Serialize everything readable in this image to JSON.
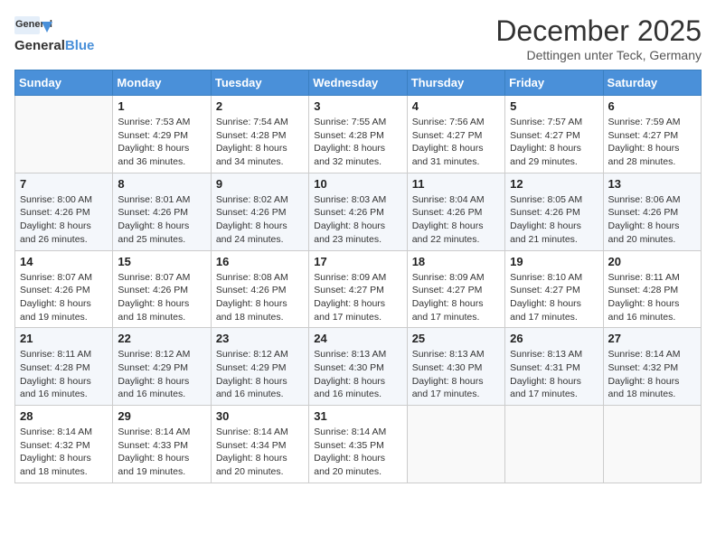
{
  "header": {
    "logo_general": "General",
    "logo_blue": "Blue",
    "month": "December 2025",
    "location": "Dettingen unter Teck, Germany"
  },
  "weekdays": [
    "Sunday",
    "Monday",
    "Tuesday",
    "Wednesday",
    "Thursday",
    "Friday",
    "Saturday"
  ],
  "weeks": [
    [
      {
        "day": "",
        "info": ""
      },
      {
        "day": "1",
        "info": "Sunrise: 7:53 AM\nSunset: 4:29 PM\nDaylight: 8 hours\nand 36 minutes."
      },
      {
        "day": "2",
        "info": "Sunrise: 7:54 AM\nSunset: 4:28 PM\nDaylight: 8 hours\nand 34 minutes."
      },
      {
        "day": "3",
        "info": "Sunrise: 7:55 AM\nSunset: 4:28 PM\nDaylight: 8 hours\nand 32 minutes."
      },
      {
        "day": "4",
        "info": "Sunrise: 7:56 AM\nSunset: 4:27 PM\nDaylight: 8 hours\nand 31 minutes."
      },
      {
        "day": "5",
        "info": "Sunrise: 7:57 AM\nSunset: 4:27 PM\nDaylight: 8 hours\nand 29 minutes."
      },
      {
        "day": "6",
        "info": "Sunrise: 7:59 AM\nSunset: 4:27 PM\nDaylight: 8 hours\nand 28 minutes."
      }
    ],
    [
      {
        "day": "7",
        "info": "Sunrise: 8:00 AM\nSunset: 4:26 PM\nDaylight: 8 hours\nand 26 minutes."
      },
      {
        "day": "8",
        "info": "Sunrise: 8:01 AM\nSunset: 4:26 PM\nDaylight: 8 hours\nand 25 minutes."
      },
      {
        "day": "9",
        "info": "Sunrise: 8:02 AM\nSunset: 4:26 PM\nDaylight: 8 hours\nand 24 minutes."
      },
      {
        "day": "10",
        "info": "Sunrise: 8:03 AM\nSunset: 4:26 PM\nDaylight: 8 hours\nand 23 minutes."
      },
      {
        "day": "11",
        "info": "Sunrise: 8:04 AM\nSunset: 4:26 PM\nDaylight: 8 hours\nand 22 minutes."
      },
      {
        "day": "12",
        "info": "Sunrise: 8:05 AM\nSunset: 4:26 PM\nDaylight: 8 hours\nand 21 minutes."
      },
      {
        "day": "13",
        "info": "Sunrise: 8:06 AM\nSunset: 4:26 PM\nDaylight: 8 hours\nand 20 minutes."
      }
    ],
    [
      {
        "day": "14",
        "info": "Sunrise: 8:07 AM\nSunset: 4:26 PM\nDaylight: 8 hours\nand 19 minutes."
      },
      {
        "day": "15",
        "info": "Sunrise: 8:07 AM\nSunset: 4:26 PM\nDaylight: 8 hours\nand 18 minutes."
      },
      {
        "day": "16",
        "info": "Sunrise: 8:08 AM\nSunset: 4:26 PM\nDaylight: 8 hours\nand 18 minutes."
      },
      {
        "day": "17",
        "info": "Sunrise: 8:09 AM\nSunset: 4:27 PM\nDaylight: 8 hours\nand 17 minutes."
      },
      {
        "day": "18",
        "info": "Sunrise: 8:09 AM\nSunset: 4:27 PM\nDaylight: 8 hours\nand 17 minutes."
      },
      {
        "day": "19",
        "info": "Sunrise: 8:10 AM\nSunset: 4:27 PM\nDaylight: 8 hours\nand 17 minutes."
      },
      {
        "day": "20",
        "info": "Sunrise: 8:11 AM\nSunset: 4:28 PM\nDaylight: 8 hours\nand 16 minutes."
      }
    ],
    [
      {
        "day": "21",
        "info": "Sunrise: 8:11 AM\nSunset: 4:28 PM\nDaylight: 8 hours\nand 16 minutes."
      },
      {
        "day": "22",
        "info": "Sunrise: 8:12 AM\nSunset: 4:29 PM\nDaylight: 8 hours\nand 16 minutes."
      },
      {
        "day": "23",
        "info": "Sunrise: 8:12 AM\nSunset: 4:29 PM\nDaylight: 8 hours\nand 16 minutes."
      },
      {
        "day": "24",
        "info": "Sunrise: 8:13 AM\nSunset: 4:30 PM\nDaylight: 8 hours\nand 16 minutes."
      },
      {
        "day": "25",
        "info": "Sunrise: 8:13 AM\nSunset: 4:30 PM\nDaylight: 8 hours\nand 17 minutes."
      },
      {
        "day": "26",
        "info": "Sunrise: 8:13 AM\nSunset: 4:31 PM\nDaylight: 8 hours\nand 17 minutes."
      },
      {
        "day": "27",
        "info": "Sunrise: 8:14 AM\nSunset: 4:32 PM\nDaylight: 8 hours\nand 18 minutes."
      }
    ],
    [
      {
        "day": "28",
        "info": "Sunrise: 8:14 AM\nSunset: 4:32 PM\nDaylight: 8 hours\nand 18 minutes."
      },
      {
        "day": "29",
        "info": "Sunrise: 8:14 AM\nSunset: 4:33 PM\nDaylight: 8 hours\nand 19 minutes."
      },
      {
        "day": "30",
        "info": "Sunrise: 8:14 AM\nSunset: 4:34 PM\nDaylight: 8 hours\nand 20 minutes."
      },
      {
        "day": "31",
        "info": "Sunrise: 8:14 AM\nSunset: 4:35 PM\nDaylight: 8 hours\nand 20 minutes."
      },
      {
        "day": "",
        "info": ""
      },
      {
        "day": "",
        "info": ""
      },
      {
        "day": "",
        "info": ""
      }
    ]
  ]
}
